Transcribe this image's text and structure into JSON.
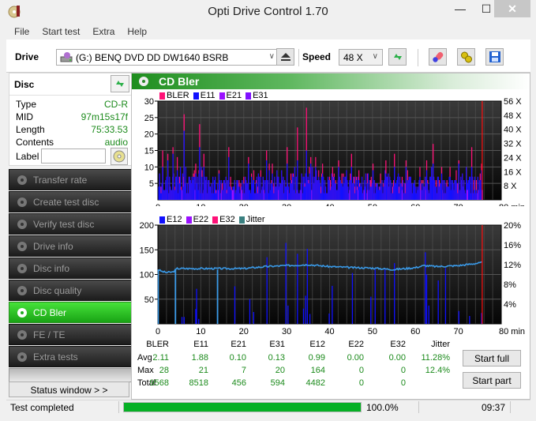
{
  "window": {
    "title": "Opti Drive Control 1.70",
    "controls": {
      "minimize": "—",
      "maximize": "☐",
      "close": "✕"
    }
  },
  "menu": [
    "File",
    "Start test",
    "Extra",
    "Help"
  ],
  "toolbar": {
    "drive_label": "Drive",
    "drive_value": "(G:)  BENQ DVD DD DW1640 BSRB",
    "speed_label": "Speed",
    "speed_value": "48 X",
    "icons": [
      "eject-icon",
      "refresh-icon",
      "eraser-icon",
      "settings-icon",
      "save-icon"
    ]
  },
  "disc": {
    "header": "Disc",
    "rows": [
      {
        "key": "Type",
        "value": "CD-R"
      },
      {
        "key": "MID",
        "value": "97m15s17f"
      },
      {
        "key": "Length",
        "value": "75:33.53"
      },
      {
        "key": "Contents",
        "value": "audio"
      }
    ],
    "label_key": "Label",
    "label_value": ""
  },
  "nav": [
    {
      "label": "Transfer rate",
      "active": false
    },
    {
      "label": "Create test disc",
      "active": false
    },
    {
      "label": "Verify test disc",
      "active": false
    },
    {
      "label": "Drive info",
      "active": false
    },
    {
      "label": "Disc info",
      "active": false
    },
    {
      "label": "Disc quality",
      "active": false
    },
    {
      "label": "CD Bler",
      "active": true
    },
    {
      "label": "FE / TE",
      "active": false
    },
    {
      "label": "Extra tests",
      "active": false
    }
  ],
  "status_window_button": "Status window > >",
  "panel": {
    "title": "CD Bler",
    "colors": {
      "bler": "#ff1177",
      "e11": "#1010ff",
      "e21": "#9a10ff",
      "e31": "#8010ff",
      "e12": "#1010ff",
      "e22": "#9a10ff",
      "e32": "#ff1177",
      "jitter": "#3a9ae8",
      "jitter_legend": "#3a8080",
      "marker": "#ff1010"
    }
  },
  "chart_data": [
    {
      "type": "bar",
      "title": "BLER / E11 / E21 / E31",
      "legend": [
        "BLER",
        "E11",
        "E21",
        "E31"
      ],
      "legend_position": "top-left",
      "x_ticks": [
        "0",
        "10",
        "20",
        "30",
        "40",
        "50",
        "60",
        "70",
        "80 min"
      ],
      "xlim": [
        0,
        80
      ],
      "y_ticks": [
        "30",
        "25",
        "20",
        "15",
        "10",
        "5"
      ],
      "ylim": [
        0,
        30
      ],
      "y2_ticks": [
        "56 X",
        "48 X",
        "40 X",
        "32 X",
        "24 X",
        "16 X",
        "8 X"
      ],
      "y2lim": [
        0,
        56
      ],
      "end_marker_min": 75.56,
      "peaks": [
        {
          "x": 1.0,
          "bler": 15,
          "e11": 10
        },
        {
          "x": 2.2,
          "bler": 14,
          "e11": 12
        },
        {
          "x": 3.4,
          "bler": 16,
          "e11": 14
        },
        {
          "x": 4.4,
          "bler": 13,
          "e11": 9
        },
        {
          "x": 6.0,
          "bler": 26,
          "e11": 21
        },
        {
          "x": 8.7,
          "bler": 11,
          "e11": 8
        },
        {
          "x": 9.6,
          "bler": 23,
          "e11": 16
        },
        {
          "x": 10.6,
          "bler": 14,
          "e11": 10
        },
        {
          "x": 16.4,
          "bler": 16,
          "e11": 13
        },
        {
          "x": 21.0,
          "bler": 13,
          "e11": 11
        },
        {
          "x": 25.2,
          "bler": 15,
          "e11": 12
        },
        {
          "x": 30.0,
          "bler": 16,
          "e11": 11
        },
        {
          "x": 32.4,
          "bler": 22,
          "e11": 12
        },
        {
          "x": 34.5,
          "bler": 28,
          "e11": 15
        },
        {
          "x": 35.5,
          "bler": 13,
          "e11": 11
        },
        {
          "x": 42.0,
          "bler": 12,
          "e11": 10
        },
        {
          "x": 45.0,
          "bler": 14,
          "e11": 10
        },
        {
          "x": 50.0,
          "bler": 11,
          "e11": 9
        },
        {
          "x": 53.0,
          "bler": 12,
          "e11": 8
        },
        {
          "x": 55.0,
          "bler": 14,
          "e11": 10
        },
        {
          "x": 62.5,
          "bler": 12,
          "e11": 9
        },
        {
          "x": 64.0,
          "bler": 17,
          "e11": 11
        },
        {
          "x": 66.0,
          "bler": 10,
          "e11": 8
        },
        {
          "x": 70.0,
          "bler": 12,
          "e11": 11
        },
        {
          "x": 73.0,
          "bler": 16,
          "e11": 10
        },
        {
          "x": 75.3,
          "bler": 11,
          "e11": 9
        }
      ]
    },
    {
      "type": "bar",
      "title": "E12 / E22 / E32 / Jitter",
      "legend": [
        "E12",
        "E22",
        "E32",
        "Jitter"
      ],
      "legend_position": "top-left",
      "x_ticks": [
        "0",
        "10",
        "20",
        "30",
        "40",
        "50",
        "60",
        "70",
        "80 min"
      ],
      "xlim": [
        0,
        80
      ],
      "y_ticks": [
        "200",
        "150",
        "100",
        "50"
      ],
      "ylim": [
        0,
        200
      ],
      "y2_ticks": [
        "20%",
        "16%",
        "12%",
        "8%",
        "4%"
      ],
      "y2lim": [
        0,
        20
      ],
      "end_marker_min": 75.56,
      "e12_peaks": [
        {
          "x": 5.5,
          "v": 14
        },
        {
          "x": 6.0,
          "v": 14
        },
        {
          "x": 8.7,
          "v": 30
        },
        {
          "x": 8.9,
          "v": 71
        },
        {
          "x": 9.4,
          "v": 10
        },
        {
          "x": 17.8,
          "v": 76
        },
        {
          "x": 21.3,
          "v": 50
        },
        {
          "x": 22.2,
          "v": 24
        },
        {
          "x": 25.3,
          "v": 135
        },
        {
          "x": 29.7,
          "v": 164
        },
        {
          "x": 30.2,
          "v": 37
        },
        {
          "x": 32.4,
          "v": 142
        },
        {
          "x": 33.8,
          "v": 31
        },
        {
          "x": 34.3,
          "v": 57
        },
        {
          "x": 34.7,
          "v": 152
        },
        {
          "x": 35.3,
          "v": 20
        },
        {
          "x": 39.8,
          "v": 21
        },
        {
          "x": 40.5,
          "v": 77
        },
        {
          "x": 45.2,
          "v": 103
        },
        {
          "x": 49.5,
          "v": 55
        },
        {
          "x": 50.5,
          "v": 110
        },
        {
          "x": 52.8,
          "v": 110
        },
        {
          "x": 55.0,
          "v": 123
        },
        {
          "x": 62.2,
          "v": 145
        },
        {
          "x": 62.5,
          "v": 100
        },
        {
          "x": 63.0,
          "v": 37
        },
        {
          "x": 65.2,
          "v": 88
        },
        {
          "x": 66.9,
          "v": 113
        },
        {
          "x": 70.0,
          "v": 26
        },
        {
          "x": 72.5,
          "v": 16
        },
        {
          "x": 75.3,
          "v": 22
        }
      ],
      "jitter_percent": [
        {
          "x": 0,
          "v": 11.0
        },
        {
          "x": 1,
          "v": 10.6
        },
        {
          "x": 2,
          "v": 10.4
        },
        {
          "x": 3.5,
          "v": 10.5
        },
        {
          "x": 4.5,
          "v": 11.2
        },
        {
          "x": 10,
          "v": 11.2
        },
        {
          "x": 20,
          "v": 11.2
        },
        {
          "x": 25,
          "v": 11.6
        },
        {
          "x": 30,
          "v": 11.8
        },
        {
          "x": 35,
          "v": 12.0
        },
        {
          "x": 40,
          "v": 11.6
        },
        {
          "x": 45,
          "v": 11.4
        },
        {
          "x": 50,
          "v": 11.3
        },
        {
          "x": 55,
          "v": 11.0
        },
        {
          "x": 60,
          "v": 11.4
        },
        {
          "x": 62,
          "v": 11.8
        },
        {
          "x": 65,
          "v": 11.6
        },
        {
          "x": 70,
          "v": 11.8
        },
        {
          "x": 75.5,
          "v": 12.4
        }
      ],
      "jitter_dropouts_min": [
        4.1,
        13.9
      ]
    }
  ],
  "stats": {
    "columns": [
      "BLER",
      "E11",
      "E21",
      "E31",
      "E12",
      "E22",
      "E32",
      "Jitter"
    ],
    "rows": [
      {
        "label": "Avg",
        "values": [
          "2.11",
          "1.88",
          "0.10",
          "0.13",
          "0.99",
          "0.00",
          "0.00",
          "11.28%"
        ]
      },
      {
        "label": "Max",
        "values": [
          "28",
          "21",
          "7",
          "20",
          "164",
          "0",
          "0",
          "12.4%"
        ]
      },
      {
        "label": "Total",
        "values": [
          "9568",
          "8518",
          "456",
          "594",
          "4482",
          "0",
          "0",
          ""
        ]
      }
    ]
  },
  "buttons": {
    "start_full": "Start full",
    "start_part": "Start part"
  },
  "statusbar": {
    "text": "Test completed",
    "progress_percent": 100,
    "progress_label": "100.0%",
    "time": "09:37"
  }
}
